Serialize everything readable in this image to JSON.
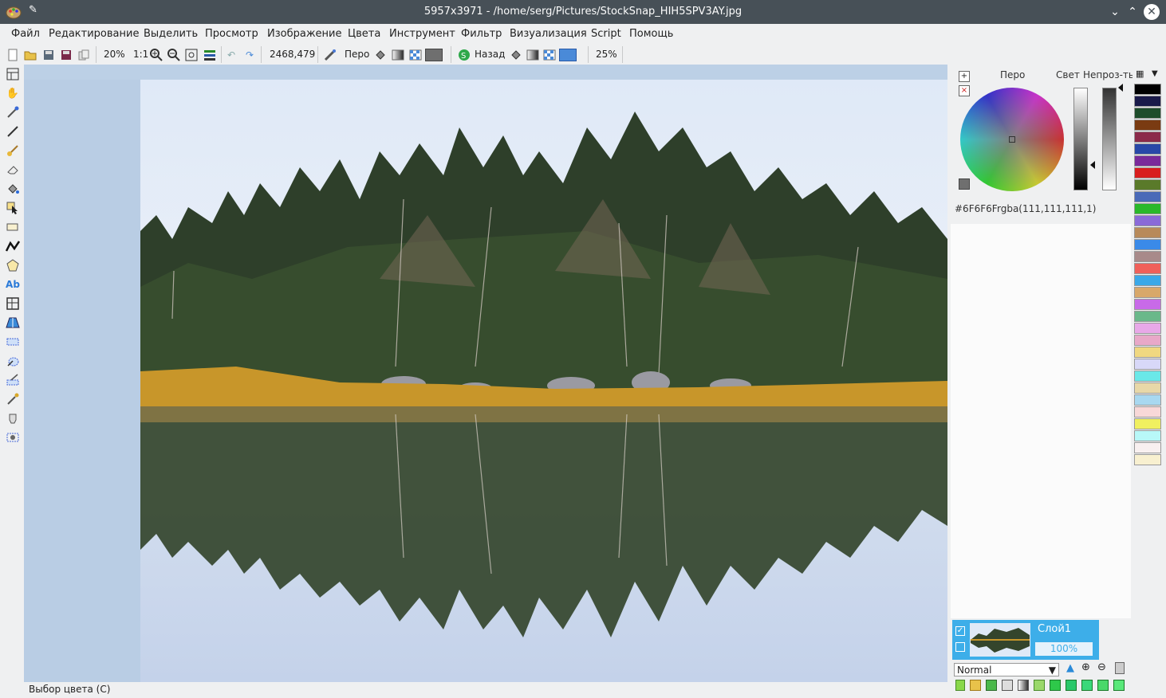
{
  "window": {
    "title": "5957x3971 - /home/serg/Pictures/StockSnap_HIH5SPV3AY.jpg",
    "controls": [
      "minimize-icon",
      "maximize-icon",
      "close-icon"
    ]
  },
  "menu": {
    "items": [
      "Файл",
      "Редактирование",
      "Выделить",
      "Просмотр",
      "Изображение",
      "Цвета",
      "Инструмент",
      "Фильтр",
      "Визуализация",
      "Script",
      "Помощь"
    ]
  },
  "toolbar": {
    "zoom": "20%",
    "actual_size": "1:1",
    "cursor_position": "2468,479",
    "primary_label": "Перо",
    "secondary_label": "Назад",
    "opacity": "25%"
  },
  "tools": [
    "layout-icon",
    "hand-icon",
    "color-picker-icon",
    "pencil-icon",
    "brush-icon",
    "eraser-icon",
    "fill-icon",
    "select-pointer-icon",
    "rectangle-icon",
    "polyline-icon",
    "polygon-icon",
    "text-icon",
    "crop-icon",
    "perspective-icon",
    "rect-select-icon",
    "magic-wand-icon",
    "select-brush-icon",
    "pipette-icon",
    "clone-icon",
    "selection-edit-icon"
  ],
  "color_panel": {
    "primary_label": "Перо",
    "light_label": "Свет",
    "opacity_label": "Непроз-ть",
    "hex": "#6F6F6F",
    "rgba": "rgba(111,111,111,1)"
  },
  "layers": {
    "name": "Слой1",
    "opacity": "100%",
    "blend_mode": "Normal"
  },
  "palette": [
    "#000000",
    "#1a1a4a",
    "#1e4d2b",
    "#7a3b12",
    "#8b2a4a",
    "#2848a8",
    "#7a2a9a",
    "#d81e1e",
    "#5a7a2a",
    "#4a6ab8",
    "#2ab82a",
    "#8a6ad8",
    "#b88a5a",
    "#3a8ae8",
    "#a88a8a",
    "#f0605a",
    "#3aa8e8",
    "#d8a86a",
    "#c86ae8",
    "#6ab88a",
    "#e8a8e8",
    "#e8a8c8",
    "#f0d880",
    "#d8d8f8",
    "#6ae8e8",
    "#e8d8a8",
    "#a8d8f0",
    "#f8d8d8",
    "#f0f060",
    "#b8f8f8",
    "#f8f0f0",
    "#f8f0d0"
  ],
  "status": {
    "text": "Выбор цвета (С)"
  }
}
